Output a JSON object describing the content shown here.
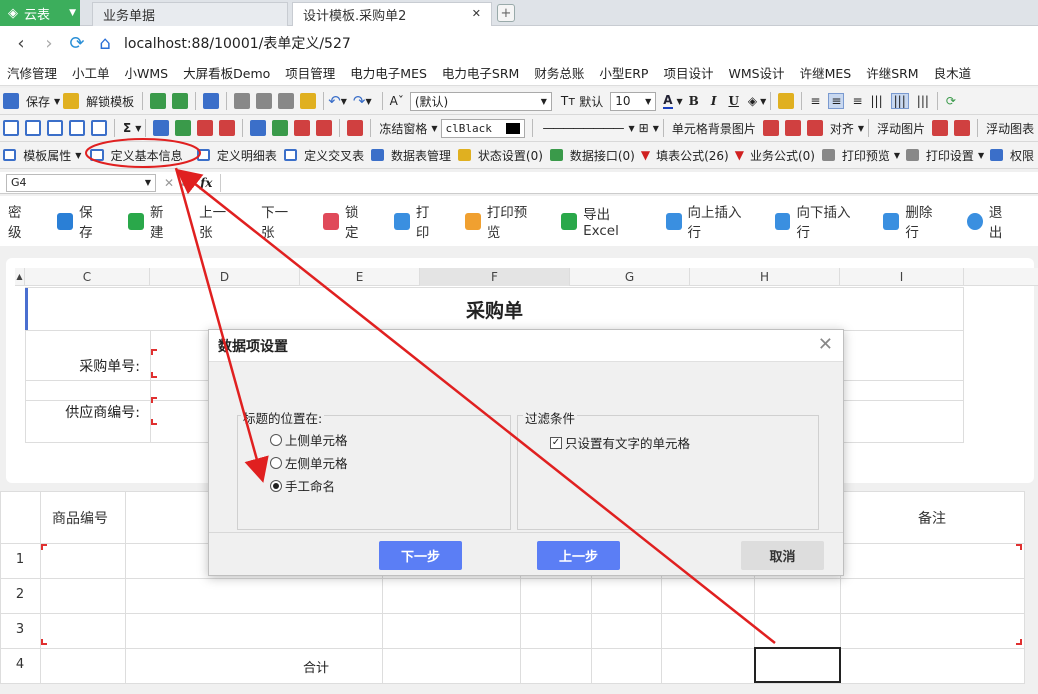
{
  "browser": {
    "app_tab_label": "云表",
    "tabs": [
      "业务单据",
      "设计模板.采购单2"
    ],
    "url": "localhost:88/10001/表单定义/527"
  },
  "bookmarks": [
    "汽修管理",
    "小工单",
    "小WMS",
    "大屏看板Demo",
    "项目管理",
    "电力电子MES",
    "电力电子SRM",
    "财务总账",
    "小型ERP",
    "项目设计",
    "WMS设计",
    "许继MES",
    "许继SRM",
    "良木道"
  ],
  "toolbar1": {
    "save": "保存",
    "unlock": "解锁模板",
    "font": "(默认)",
    "font_prefix": "Tт",
    "default_label": "默认",
    "font_size": "10",
    "bold": "B",
    "italic": "I",
    "underline": "U"
  },
  "toolbar2": {
    "freeze": "冻结窗格",
    "color": "clBlack",
    "cell_bg": "单元格背景图片",
    "align": "对齐",
    "float_img": "浮动图片",
    "float_chart": "浮动图表"
  },
  "toolbar3": {
    "items": [
      "模板属性",
      "定义基本信息",
      "定义明细表",
      "定义交叉表",
      "数据表管理",
      "状态设置(0)",
      "数据接口(0)",
      "填表公式(26)",
      "业务公式(0)",
      "打印预览",
      "打印设置",
      "权限"
    ]
  },
  "formula_bar": {
    "cell": "G4",
    "fx": "fx"
  },
  "app_toolbar": [
    "密级",
    "保存",
    "新建",
    "上一张",
    "下一张",
    "锁定",
    "打印",
    "打印预览",
    "导出Excel",
    "向上插入行",
    "向下插入行",
    "删除行",
    "退出"
  ],
  "sheet": {
    "columns": [
      "C",
      "D",
      "E",
      "F",
      "G",
      "H",
      "I"
    ],
    "title": "采购单",
    "po_label": "采购单号:",
    "vendor_label": "供应商编号:"
  },
  "detail": {
    "headers": [
      "商品编号",
      "备注"
    ],
    "rows": [
      "1",
      "2",
      "3",
      "4"
    ],
    "total": "合计"
  },
  "dialog": {
    "title": "数据项设置",
    "group_position": "标题的位置在:",
    "opt_top": "上侧单元格",
    "opt_left": "左侧单元格",
    "opt_manual": "手工命名",
    "selected": "手工命名",
    "group_filter": "过滤条件",
    "filter_check": "只设置有文字的单元格",
    "filter_checked": true,
    "next": "下一步",
    "prev": "上一步",
    "cancel": "取消"
  },
  "colors": {
    "accent_green": "#3cae5c",
    "primary_button": "#5b7ef5",
    "annotation_red": "#e02020"
  }
}
